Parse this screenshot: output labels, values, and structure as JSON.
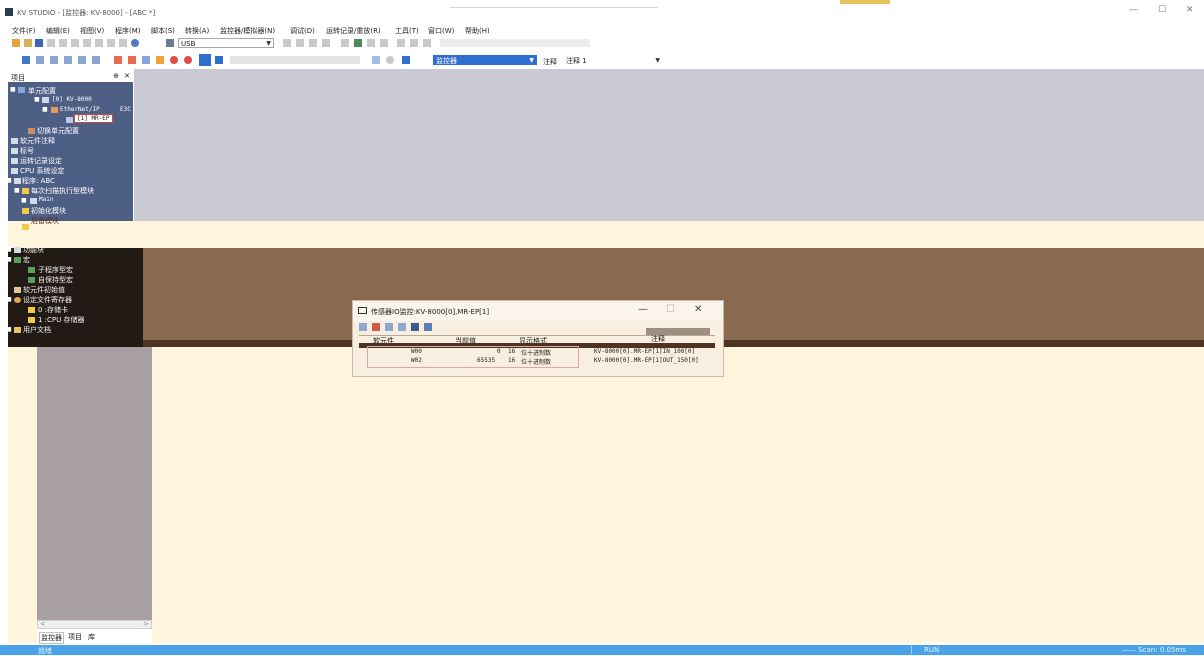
{
  "window": {
    "title": "KV STUDIO - [监控器: KV-8000] - [ABC *]",
    "controls": {
      "minimize": "—",
      "maximize": "☐",
      "close": "✕"
    }
  },
  "menu": {
    "items": [
      "文件(F)",
      "编辑(E)",
      "视图(V)",
      "程序(M)",
      "脚本(S)",
      "转换(A)",
      "监控器/模拟器(N)",
      "调试(D)",
      "运转记录/重放(R)",
      "工具(T)",
      "窗口(W)",
      "帮助(H)"
    ]
  },
  "toolbar": {
    "connection_value": "USB",
    "mode_value": "监控器",
    "comment_label": "注释",
    "comment_value": "注释 1"
  },
  "project_pane": {
    "title": "项目",
    "pin": "⊕",
    "close": "✕",
    "tree": {
      "unit_config": "单元配置",
      "unit_cpu": "[0]  KV-8000",
      "ethernet": "EtherNet/IP",
      "ethernet_extra": "E3C",
      "mr_ep": "[1]  MR-EP",
      "switch_unit": "切换单元配置",
      "device_comment": "软元件注释",
      "label": "标号",
      "run_record": "运转记录设定",
      "cpu_setting": "CPU 系统设定",
      "program": "程序: ABC",
      "scan_module": "每次扫描执行型模块",
      "main": "Main",
      "init_module": "初始化模块",
      "standby_module": "后备模块",
      "func_block": "功能块",
      "macro": "宏",
      "subroutine_macro": "子程序型宏",
      "self_hold_macro": "自保持型宏",
      "device_init": "软元件初始值",
      "file_register": "设定文件寄存器",
      "card0": "0 :存储卡",
      "cpu_mem": "1 :CPU 存储器",
      "user_doc": "用户文档"
    },
    "scroll_left": "<",
    "scroll_right": ">",
    "tabs": [
      "监控器",
      "项目",
      "库"
    ]
  },
  "io_dialog": {
    "title": "传感器IO监控:KV-8000[0],MR-EP[1]",
    "controls": {
      "minimize": "—",
      "maximize": "☐",
      "close": "✕"
    },
    "columns": [
      "软元件",
      "当前值",
      "显示格式",
      "注释"
    ],
    "rows": [
      {
        "device": "W00",
        "value": "0",
        "bits": "16",
        "format": "位十进制数",
        "comment": "KV-8000[0].MR-EP[1]IN_100[0]"
      },
      {
        "device": "W02",
        "value": "65535",
        "bits": "16",
        "format": "位十进制数",
        "comment": "KV-8000[0].MR-EP[1]OUT_150[0]"
      }
    ]
  },
  "status": {
    "left": "就绪",
    "run": "RUN",
    "scan": "—— Scan:  0.05ms"
  }
}
